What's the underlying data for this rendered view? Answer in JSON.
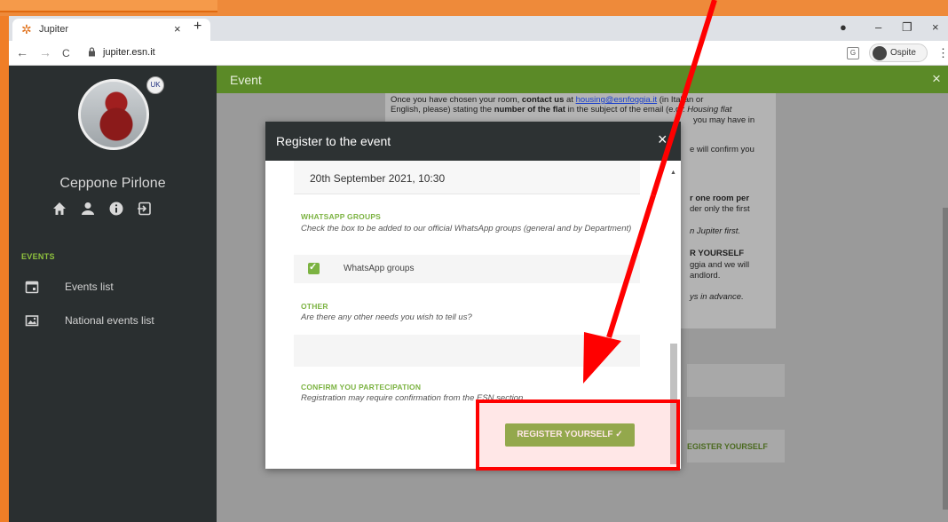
{
  "browser": {
    "tab_title": "Jupiter",
    "tab_close": "×",
    "new_tab": "+",
    "url": "jupiter.esn.it",
    "profile_label": "Ospite",
    "back": "←",
    "forward": "→",
    "reload": "C",
    "menu": "⋮",
    "min": "–",
    "max": "❐",
    "close": "×"
  },
  "sidebar": {
    "username": "Ceppone Pirlone",
    "flag": "🇬🇧",
    "section_label": "EVENTS",
    "items": [
      {
        "label": "Events list",
        "icon": "calendar-icon"
      },
      {
        "label": "National events list",
        "icon": "image-icon"
      }
    ]
  },
  "main": {
    "header_title": "Event",
    "header_close": "×",
    "bg_lines": [
      {
        "pre": "Once you have chosen your room, ",
        "bold": "contact us",
        "mid": " at ",
        "link": "housing@esnfoggia.it",
        "post": " (in Italian or"
      },
      {
        "pre": "English, please) stating the ",
        "bold": "number of the flat",
        "mid": " in the subject of the email (e.g.: ",
        "link": "",
        "post": "Housing flat"
      },
      {
        "pre": "",
        "bold": "",
        "mid": "",
        "link": "",
        "post": "you may have in"
      },
      {
        "pre": "",
        "bold": "",
        "mid": "",
        "link": "",
        "post": "e will confirm you"
      },
      {
        "pre": "",
        "bold": "",
        "mid": "",
        "link": "",
        "post": "r one room per"
      },
      {
        "pre": "",
        "bold": "",
        "mid": "",
        "link": "",
        "post": "der only the first"
      },
      {
        "pre": "",
        "bold": "",
        "mid": "",
        "link": "",
        "post": "n Jupiter first."
      },
      {
        "pre": "",
        "bold": "",
        "mid": "",
        "link": "",
        "post": "R YOURSELF"
      },
      {
        "pre": "",
        "bold": "",
        "mid": "",
        "link": "",
        "post": "ggia and we will"
      },
      {
        "pre": "",
        "bold": "",
        "mid": "",
        "link": "",
        "post": "andlord."
      },
      {
        "pre": "",
        "bold": "",
        "mid": "",
        "link": "",
        "post": "ys in advance."
      }
    ],
    "bg_register": "EGISTER YOURSELF"
  },
  "modal": {
    "title": "Register to the event",
    "close": "×",
    "date": "20th September 2021, 10:30",
    "whatsapp_label": "WHATSAPP GROUPS",
    "whatsapp_desc": "Check the box to be added to our official WhatsApp groups (general and by Department)",
    "whatsapp_check": "WhatsApp groups",
    "other_label": "OTHER",
    "other_desc": "Are there any other needs you wish to tell us?",
    "confirm_label": "CONFIRM YOU PARTECIPATION",
    "confirm_desc": "Registration may require confirmation from the ESN section.",
    "register_button": "REGISTER YOURSELF ✓"
  },
  "colors": {
    "accent_green": "#7cb342",
    "header_green": "#5b8a27",
    "annotation_red": "#ff0000",
    "border_orange": "#f07e27"
  }
}
